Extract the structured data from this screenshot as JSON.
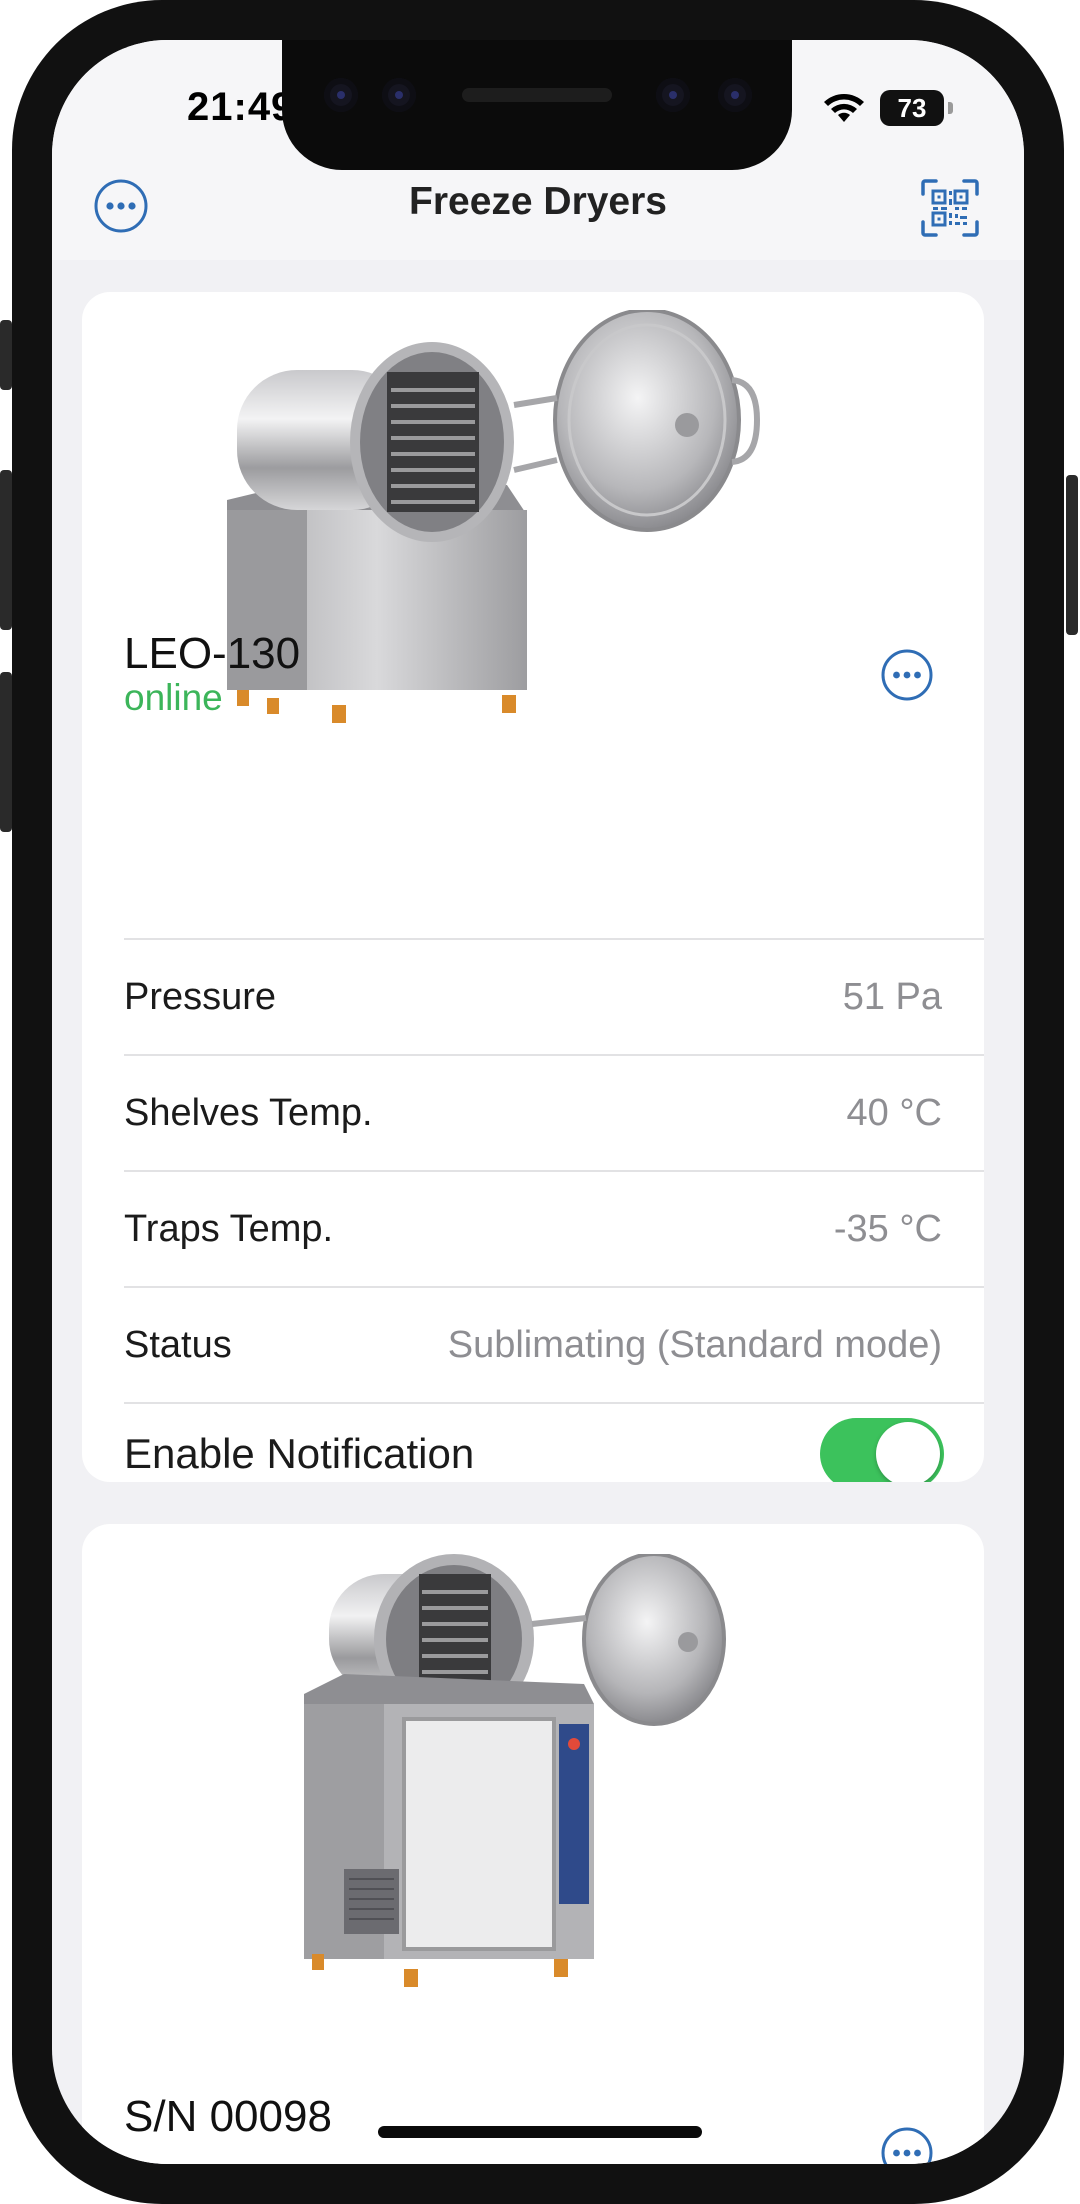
{
  "status_bar": {
    "time": "21:49",
    "battery": "73"
  },
  "nav": {
    "title": "Freeze Dryers",
    "more_icon": "ellipsis-circle-icon",
    "scan_icon": "qr-code-scan-icon"
  },
  "devices": [
    {
      "name": "LEO-130",
      "connection": "online",
      "rows": [
        {
          "label": "Pressure",
          "value": "51 Pa"
        },
        {
          "label": "Shelves Temp.",
          "value": "40 °C"
        },
        {
          "label": "Traps Temp.",
          "value": "-35 °C"
        },
        {
          "label": "Status",
          "value": "Sublimating (Standard mode)"
        }
      ],
      "notification": {
        "label": "Enable Notification",
        "enabled": true
      }
    },
    {
      "name": "S/N 00098"
    }
  ],
  "colors": {
    "accent": "#2f6db5",
    "online": "#3cb55a",
    "toggle_on": "#3cc25c"
  }
}
